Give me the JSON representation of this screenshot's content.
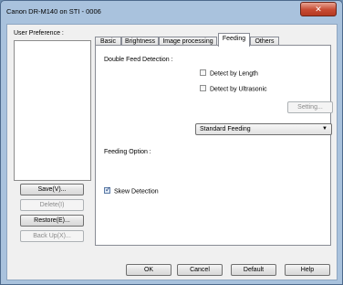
{
  "window": {
    "title": "Canon DR-M140 on STI - 0006"
  },
  "user_preference": {
    "label": "User Preference :",
    "buttons": {
      "save": "Save(V)...",
      "delete": "Delete(I)",
      "restore": "Restore(E)...",
      "backup": "Back Up(X)..."
    }
  },
  "tabs": [
    {
      "label": "Basic"
    },
    {
      "label": "Brightness"
    },
    {
      "label": "Image processing"
    },
    {
      "label": "Feeding",
      "active": true
    },
    {
      "label": "Others"
    }
  ],
  "feeding": {
    "double_feed_label": "Double Feed Detection :",
    "detect_length": {
      "label": "Detect by Length",
      "checked": false
    },
    "detect_ultrasonic": {
      "label": "Detect by Ultrasonic",
      "checked": false
    },
    "setting_button": "Setting...",
    "feeding_option_label": "Feeding Option :",
    "feeding_option_value": "Standard Feeding",
    "skew_detection": {
      "label": "Skew Detection",
      "checked": true
    }
  },
  "footer": {
    "ok": "OK",
    "cancel": "Cancel",
    "default": "Default",
    "help": "Help"
  },
  "colors": {
    "close_button": "#c74a32",
    "title_bar": "#a9c2dd"
  }
}
